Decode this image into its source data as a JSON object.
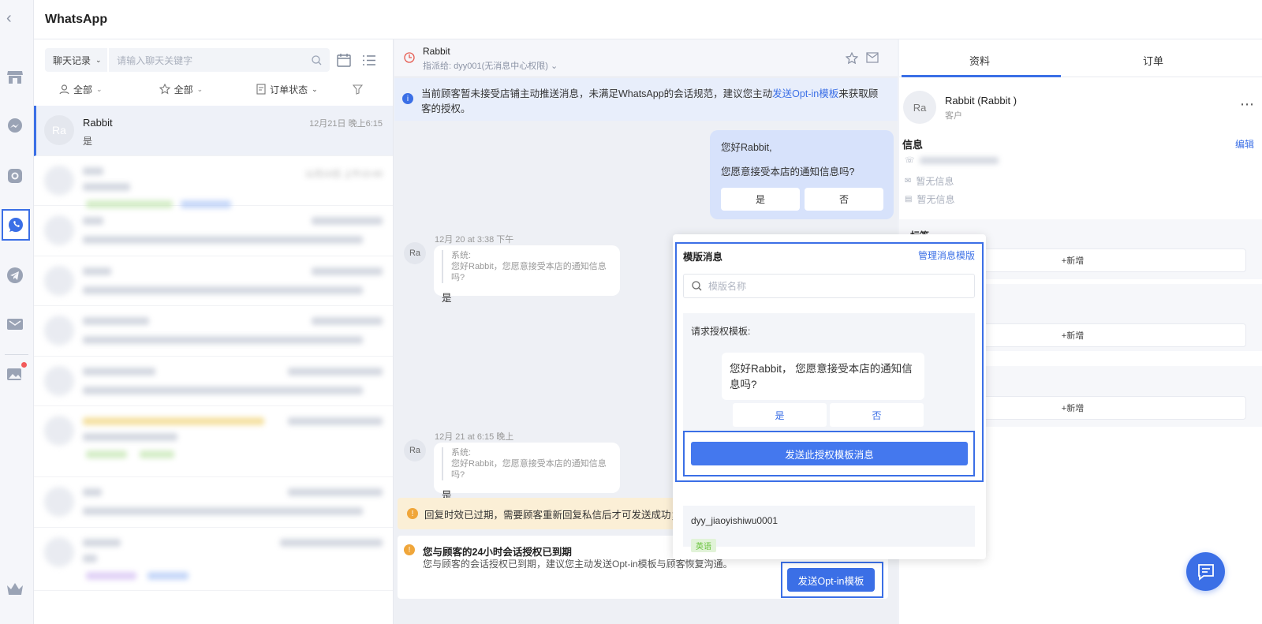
{
  "app": {
    "title": "WhatsApp"
  },
  "nav": {
    "items": [
      {
        "icon": "store-icon"
      },
      {
        "icon": "messenger-icon"
      },
      {
        "icon": "instagram-icon"
      },
      {
        "icon": "whatsapp-icon",
        "active": true
      },
      {
        "icon": "telegram-icon"
      },
      {
        "icon": "sms-icon"
      },
      {
        "icon": "image-ad-icon"
      },
      {
        "icon": "crown-icon"
      }
    ]
  },
  "chatlist": {
    "scope_select": "聊天记录",
    "search_placeholder": "请输入聊天关键字",
    "filters": {
      "agent": "全部",
      "star": "全部",
      "order": "订单状态"
    },
    "active_conversation": {
      "avatar": "Ra",
      "name": "Rabbit",
      "time": "12月21日 晚上6:15",
      "preview": "是"
    },
    "blurred_time": "11月10日 上午10:40"
  },
  "chat": {
    "contact_name": "Rabbit",
    "assigned_to": "指派给: dyy001(无消息中心权限)",
    "notice_prefix": "当前顾客暂未接受店铺主动推送消息，未满足WhatsApp的会话规范，建议您主动",
    "notice_link": "发送Opt-in模板",
    "notice_suffix": "来获取顾客的授权。",
    "outgoing": {
      "greeting": "您好Rabbit,",
      "question": "您愿意接受本店的通知信息吗?",
      "yes": "是",
      "no": "否"
    },
    "messages": [
      {
        "avatar": "Ra",
        "timestamp": "12月 20 at 3:38 下午",
        "quote_label": "系统:",
        "quote_text": "您好Rabbit，您愿意接受本店的通知信息吗?",
        "answer": "是"
      },
      {
        "avatar": "Ra",
        "timestamp": "12月 21 at 6:15 晚上",
        "quote_label": "系统:",
        "quote_text": "您好Rabbit，您愿意接受本店的通知信息吗?",
        "answer": "是"
      }
    ],
    "warning": "回复时效已过期，需要顾客重新回复私信后才可发送成功；您",
    "expired_title": "您与顾客的24小时会话授权已到期",
    "expired_desc": "您与顾客的会话授权已到期，建议您主动发送Opt-in模板与顾客恢复沟通。",
    "optin_button": "发送Opt-in模板"
  },
  "template_popup": {
    "title": "模版消息",
    "manage": "管理消息模版",
    "search_placeholder": "模版名称",
    "section_label": "请求授权模板:",
    "bubble_text": "您好Rabbit， 您愿意接受本店的通知信息吗?",
    "yes": "是",
    "no": "否",
    "send_button": "发送此授权模板消息",
    "second_template": "dyy_jiaoyishiwu0001",
    "second_tag": "英语"
  },
  "profile": {
    "tabs": [
      "资料",
      "订单"
    ],
    "avatar": "Ra",
    "name": "Rabbit (Rabbit )",
    "role": "客户",
    "info_title": "信息",
    "edit": "编辑",
    "email": "暂无信息",
    "address": "暂无信息",
    "tag_title": "标签",
    "add_label": "+新增"
  },
  "colors": {
    "accent": "#3b6fe6",
    "warning": "#f0a63a",
    "notice_bg": "#e8eefb"
  }
}
